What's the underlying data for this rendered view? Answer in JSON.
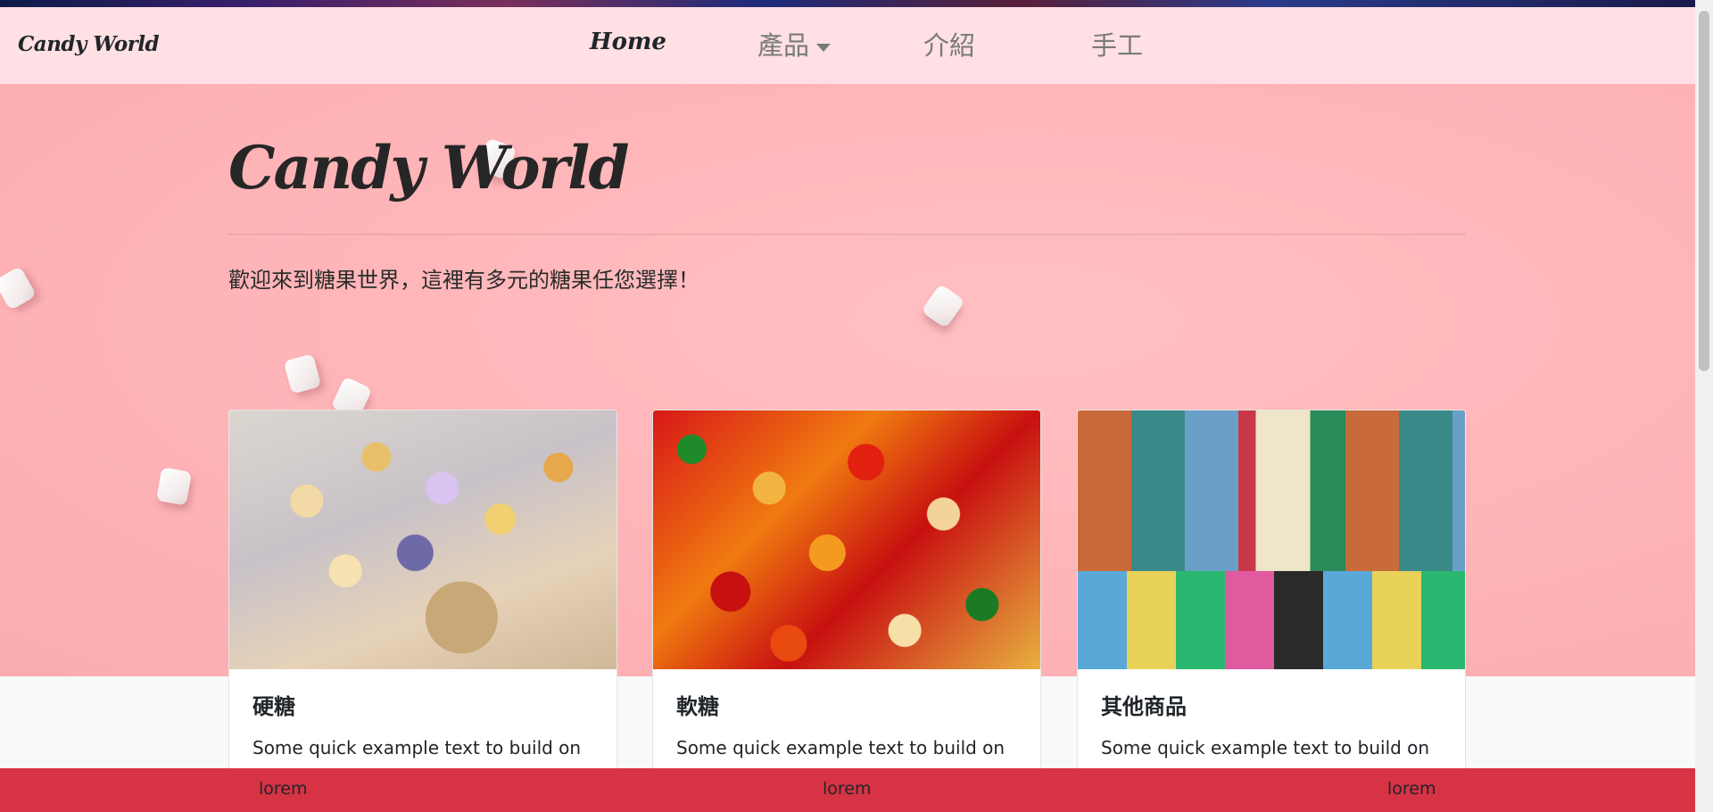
{
  "navbar": {
    "brand": "Candy World",
    "links": [
      {
        "label": "Home",
        "active": true
      },
      {
        "label": "產品",
        "dropdown": true
      },
      {
        "label": "介紹"
      },
      {
        "label": "手工"
      }
    ]
  },
  "hero": {
    "title": "Candy World",
    "lead": "歡迎來到糖果世界，這裡有多元的糖果任您選擇！"
  },
  "cards": [
    {
      "title": "硬糖",
      "text": "Some quick example text to build on the card title and make up the bulk of the card's content.",
      "image": "lollipop-cake-pops-photo"
    },
    {
      "title": "軟糖",
      "text": "Some quick example text to build on the card title and make up the bulk of the card's content.",
      "image": "gummy-bears-photo"
    },
    {
      "title": "其他商品",
      "text": "Some quick example text to build on the card title and make up the bulk of the card's content.",
      "image": "candy-tins-photo"
    }
  ],
  "footer": {
    "items": [
      "lorem",
      "lorem",
      "lorem"
    ]
  },
  "colors": {
    "navbar_bg": "#ffe0e4",
    "hero_bg": "#ffb6b9",
    "footer_bg": "#d63344"
  }
}
